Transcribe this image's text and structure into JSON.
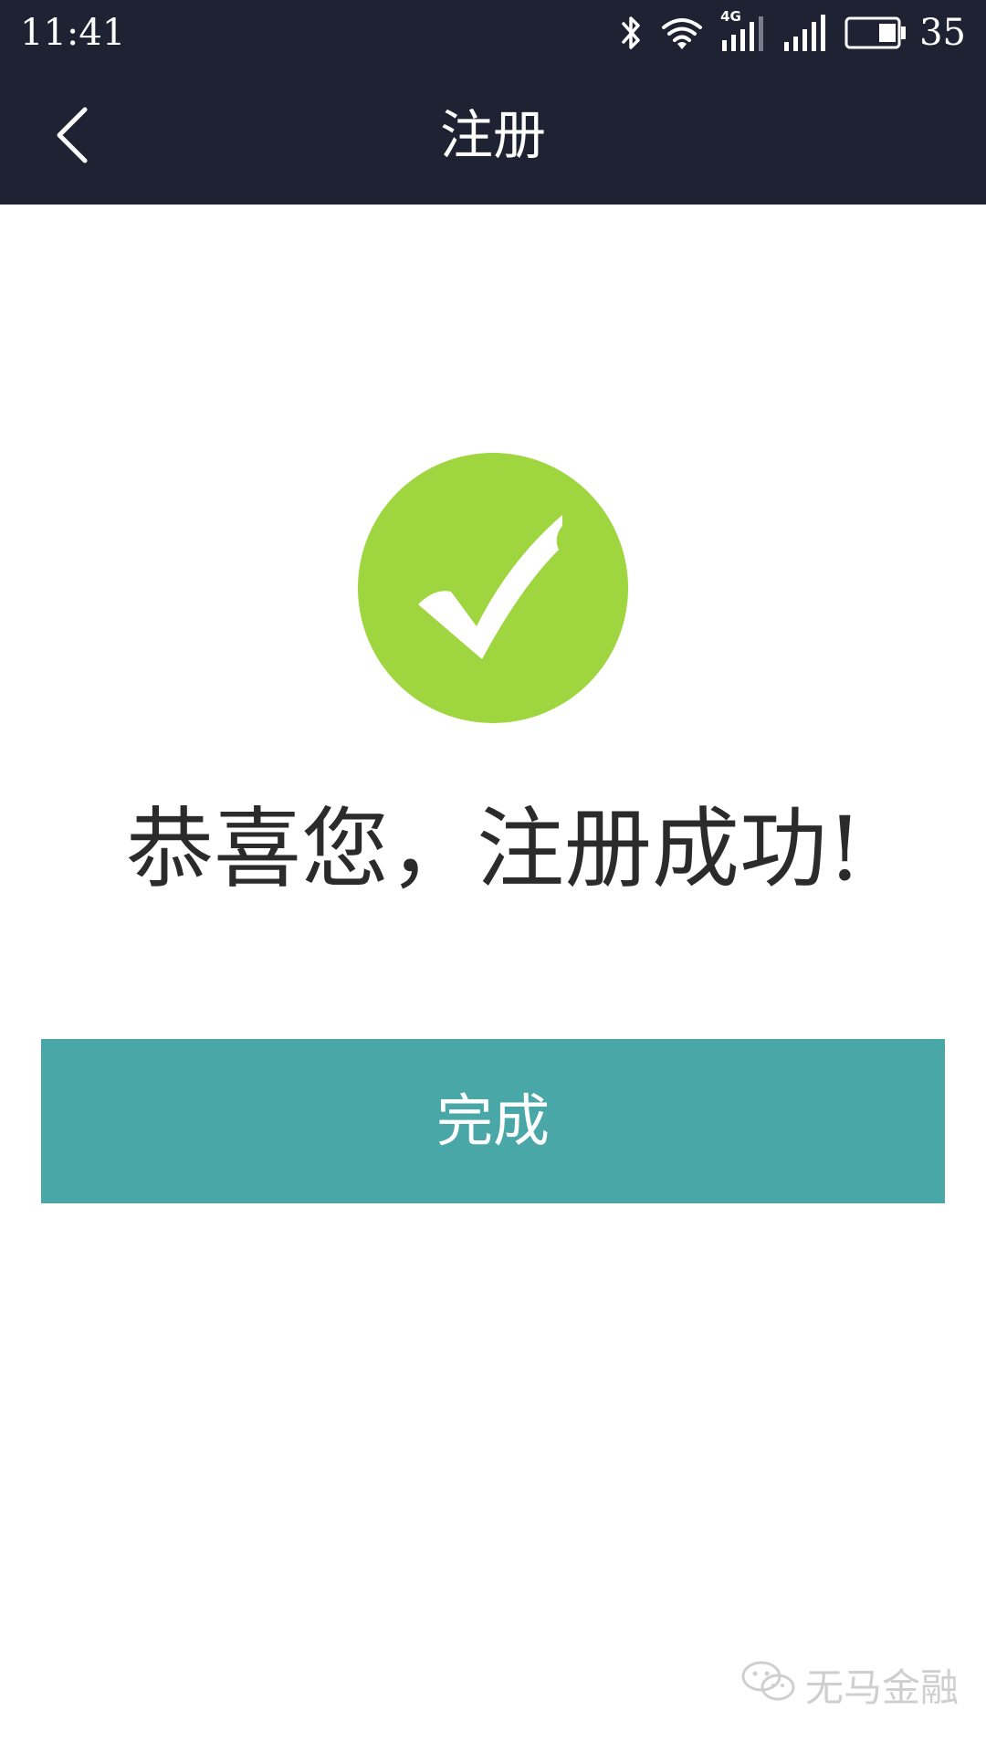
{
  "status_bar": {
    "time": "11:41",
    "network_label": "4G",
    "battery_level": "35",
    "icons": [
      "bluetooth-icon",
      "wifi-icon",
      "cellular-4g-icon",
      "cellular-signal-icon",
      "battery-icon"
    ]
  },
  "header": {
    "title": "注册",
    "back_icon": "chevron-left-icon"
  },
  "main": {
    "success_icon": "check-circle-icon",
    "message": "恭喜您，注册成功!",
    "finish_button_label": "完成"
  },
  "watermark": {
    "text": "无马金融",
    "logo": "wechat-icon"
  },
  "colors": {
    "header_bg": "#1f2233",
    "success_green": "#9fd53f",
    "button_teal": "#4aa7a8",
    "message_text": "#2b2b2b"
  }
}
